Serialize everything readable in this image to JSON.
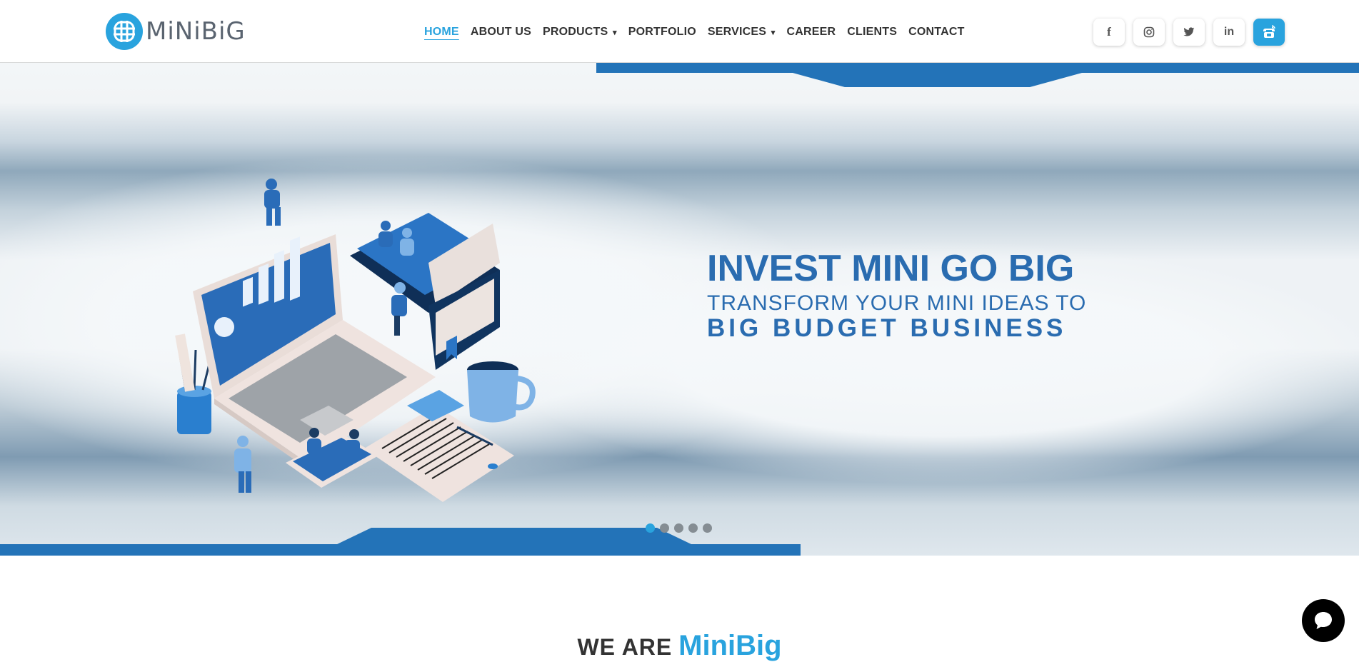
{
  "brand": {
    "logo_text": "MiNiBiG"
  },
  "nav": {
    "items": [
      {
        "label": "HOME"
      },
      {
        "label": "ABOUT US"
      },
      {
        "label": "PRODUCTS",
        "caret": "▾"
      },
      {
        "label": "PORTFOLIO"
      },
      {
        "label": "SERVICES",
        "caret": "▾"
      },
      {
        "label": "CAREER"
      },
      {
        "label": "CLIENTS"
      },
      {
        "label": "CONTACT"
      }
    ],
    "active": "HOME"
  },
  "social": {
    "facebook": "f",
    "instagram": "instagram-icon",
    "twitter": "twitter-icon",
    "linkedin": "in",
    "phone": "phone-icon"
  },
  "hero": {
    "headline": "INVEST MINI GO BIG",
    "subline": "TRANSFORM YOUR MINI IDEAS TO",
    "tagline": "BIG BUDGET BUSINESS",
    "slides": 5,
    "active_slide": 1
  },
  "section": {
    "prefix": "WE ARE",
    "brand": "MiniBig"
  },
  "colors": {
    "accent": "#29a3de",
    "band": "#2373b8",
    "headline": "#2a6cb0"
  }
}
